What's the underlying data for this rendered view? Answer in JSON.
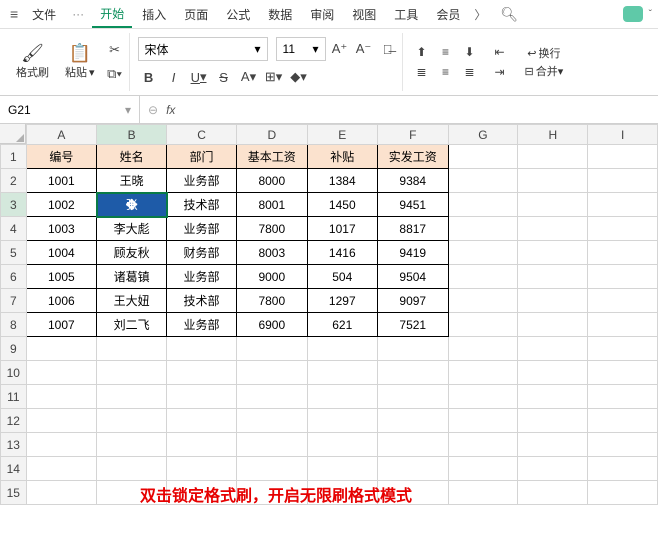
{
  "menu": {
    "file": "文件",
    "tabs": [
      "开始",
      "插入",
      "页面",
      "公式",
      "数据",
      "审阅",
      "视图",
      "工具",
      "会员"
    ],
    "active_tab": "开始"
  },
  "ribbon": {
    "format_painter": "格式刷",
    "paste": "粘贴",
    "font_name": "宋体",
    "font_size": "11",
    "bold": "B",
    "italic": "I",
    "underline": "U",
    "strike": "S",
    "font_inc": "A⁺",
    "font_dec": "A⁻",
    "wrap": "换行",
    "merge": "合并"
  },
  "namebox": {
    "value": "G21"
  },
  "fx": {
    "label": "fx"
  },
  "columns": [
    "A",
    "B",
    "C",
    "D",
    "E",
    "F",
    "G",
    "H",
    "I"
  ],
  "row_count": 15,
  "active": {
    "col": "B",
    "row": 3
  },
  "headers": [
    "编号",
    "姓名",
    "部门",
    "基本工资",
    "补贴",
    "实发工资"
  ],
  "rows": [
    [
      "1001",
      "王晓",
      "业务部",
      "8000",
      "1384",
      "9384"
    ],
    [
      "1002",
      "张",
      "技术部",
      "8001",
      "1450",
      "9451"
    ],
    [
      "1003",
      "李大彪",
      "业务部",
      "7800",
      "1017",
      "8817"
    ],
    [
      "1004",
      "顾友秋",
      "财务部",
      "8003",
      "1416",
      "9419"
    ],
    [
      "1005",
      "诸葛镇",
      "业务部",
      "9000",
      "504",
      "9504"
    ],
    [
      "1006",
      "王大妞",
      "技术部",
      "7800",
      "1297",
      "9097"
    ],
    [
      "1007",
      "刘二飞",
      "业务部",
      "6900",
      "621",
      "7521"
    ]
  ],
  "annotation": "双击锁定格式刷，开启无限刷格式模式",
  "chart_data": {
    "type": "table",
    "title": "",
    "columns": [
      "编号",
      "姓名",
      "部门",
      "基本工资",
      "补贴",
      "实发工资"
    ],
    "rows": [
      [
        1001,
        "王晓",
        "业务部",
        8000,
        1384,
        9384
      ],
      [
        1002,
        "张",
        "技术部",
        8001,
        1450,
        9451
      ],
      [
        1003,
        "李大彪",
        "业务部",
        7800,
        1017,
        8817
      ],
      [
        1004,
        "顾友秋",
        "财务部",
        8003,
        1416,
        9419
      ],
      [
        1005,
        "诸葛镇",
        "业务部",
        9000,
        504,
        9504
      ],
      [
        1006,
        "王大妞",
        "技术部",
        7800,
        1297,
        9097
      ],
      [
        1007,
        "刘二飞",
        "业务部",
        6900,
        621,
        7521
      ]
    ]
  }
}
